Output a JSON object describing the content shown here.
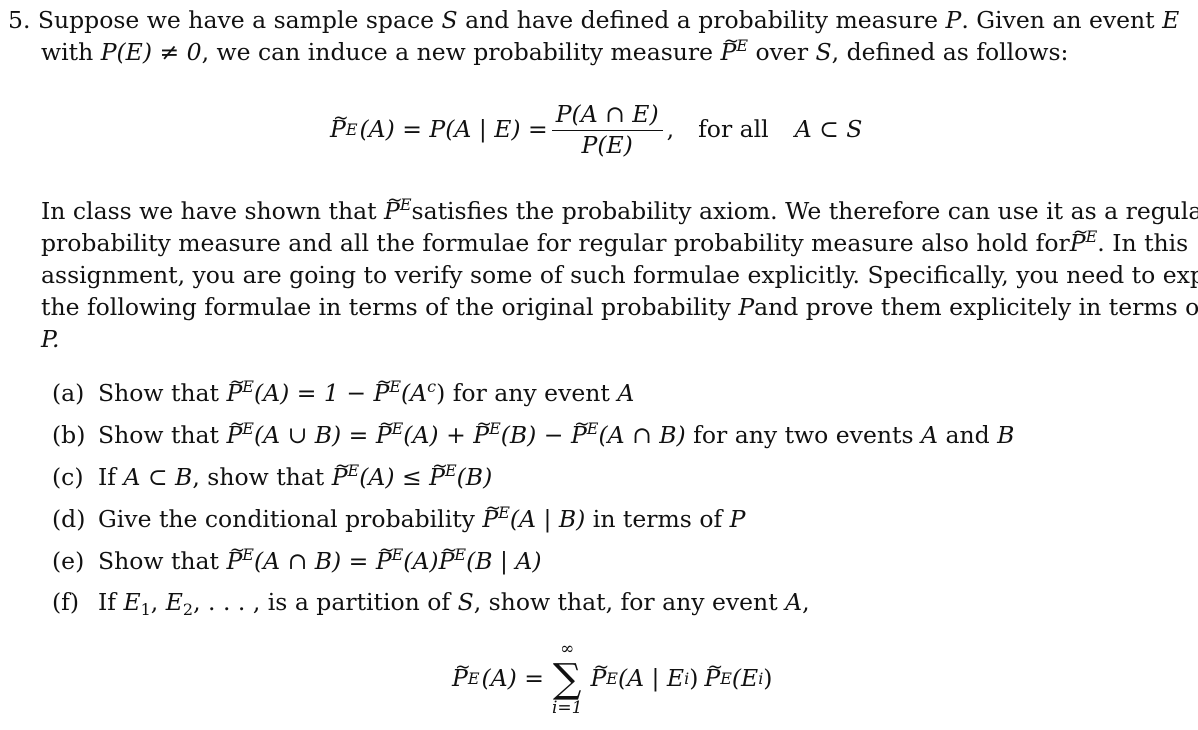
{
  "problem": {
    "number": "5.",
    "intro_line1": {
      "t1": "Suppose we have a sample space ",
      "S": "S",
      "t2": " and have defined a probability measure ",
      "P": "P",
      "t3": ".  Given an event ",
      "E": "E"
    },
    "intro_line2": {
      "t1": "with ",
      "cond": "P(E) ≠ 0",
      "t2": ", we can induce a new probability measure ",
      "t3": " over ",
      "S": "S",
      "t4": ", defined as follows:"
    },
    "definition": {
      "lhs": "(A) = P(A | E) =",
      "numerator": "P(A ∩ E)",
      "denominator": "P(E)",
      "comma": ",",
      "for_all": "for all",
      "domain": "A ⊂ S"
    },
    "paragraph": [
      "In class we have shown that",
      "satisfies the probability axiom.  We therefore can use it as a regular",
      "probability measure and all the formulae for regular probability measure also hold for",
      ".  In this",
      "assignment, you are going to verify some of such formulae explicitly.  Specifically, you need to express",
      "the following formulae in terms of the original probability",
      "P",
      "and prove them explicitely in terms of",
      "P."
    ],
    "symbol": {
      "base": "P",
      "tilde": "~",
      "sup": "E"
    },
    "items": [
      {
        "label": "(a)",
        "text1": "Show that ",
        "math1": "(A) = 1 − ",
        "math2": "(A",
        "sup2": "c",
        "math3": ")",
        "text2": " for any event ",
        "var": "A"
      },
      {
        "label": "(b)",
        "text1": "Show that ",
        "m1": "(A ∪ B) = ",
        "m2": "(A) + ",
        "m3": "(B) − ",
        "m4": "(A ∩ B)",
        "text2": " for any two events ",
        "v1": "A",
        "and": " and ",
        "v2": "B"
      },
      {
        "label": "(c)",
        "text1": "If ",
        "cond": "A ⊂ B",
        "text2": ", show that ",
        "m1": "(A) ≤ ",
        "m2": "(B)"
      },
      {
        "label": "(d)",
        "text1": "Give the conditional probability ",
        "m1": "(A | B)",
        "text2": " in terms of ",
        "var": "P"
      },
      {
        "label": "(e)",
        "text1": "Show that ",
        "m1": "(A ∩ B) = ",
        "m2": "(A)",
        "m3": "(B | A)"
      },
      {
        "label": "(f)",
        "text1": "If ",
        "e1": "E",
        "s1": "1",
        "c1": ", ",
        "e2": "E",
        "s2": "2",
        "c2": ", . . . ,",
        "text2": " is a partition of ",
        "S": "S",
        "text3": ", show that, for any event ",
        "var": "A",
        "end": ","
      }
    ],
    "partition_formula": {
      "lhs": "(A) =",
      "sum_upper": "∞",
      "sum_symbol": "∑",
      "sum_lower": "i=1",
      "t1": "(A | E",
      "i1": "i",
      "t2": ")",
      "t3": "(E",
      "i2": "i",
      "t4": ")"
    }
  }
}
